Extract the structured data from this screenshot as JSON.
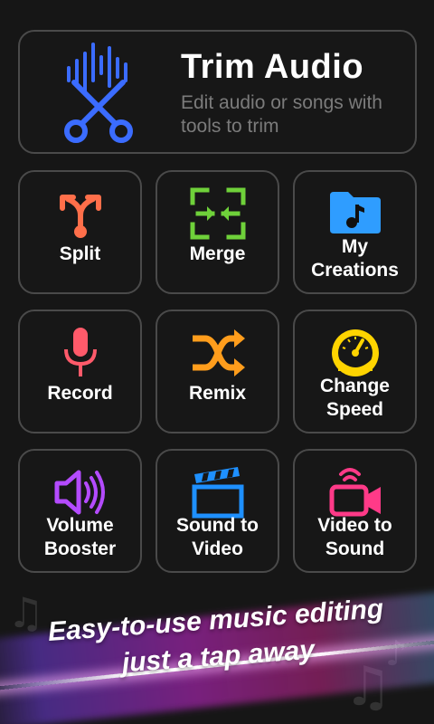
{
  "hero": {
    "title": "Trim Audio",
    "subtitle": "Edit audio or songs with tools to trim"
  },
  "tiles": [
    {
      "label": "Split",
      "icon": "split-arrow-icon"
    },
    {
      "label": "Merge",
      "icon": "merge-arrows-icon"
    },
    {
      "label": "My Creations",
      "icon": "music-folder-icon"
    },
    {
      "label": "Record",
      "icon": "microphone-icon"
    },
    {
      "label": "Remix",
      "icon": "shuffle-icon"
    },
    {
      "label": "Change Speed",
      "icon": "speedometer-icon"
    },
    {
      "label": "Volume Booster",
      "icon": "speaker-volume-icon"
    },
    {
      "label": "Sound to Video",
      "icon": "clapperboard-icon"
    },
    {
      "label": "Video to Sound",
      "icon": "video-camera-broadcast-icon"
    }
  ],
  "banner": {
    "line1": "Easy-to-use music editing",
    "line2": "just a tap away"
  },
  "colors": {
    "split": "#ff6f4a",
    "merge": "#6fd13a",
    "creations": "#2f9dff",
    "record": "#ff5a6a",
    "remix": "#ff9d1c",
    "speed": "#ffd400",
    "volume": "#b44bff",
    "video": "#1e90ff",
    "sound": "#ff3a88"
  }
}
